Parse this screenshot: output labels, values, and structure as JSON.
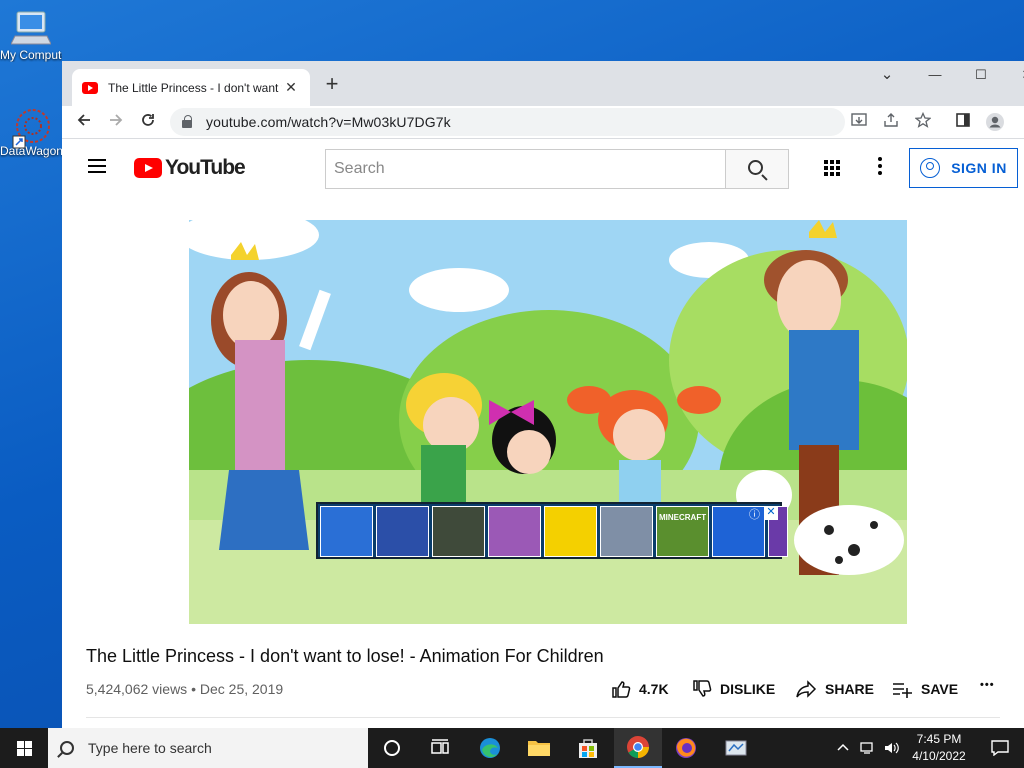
{
  "desktop": {
    "icons": [
      {
        "label": "My Computer"
      },
      {
        "label": "DataWagon"
      }
    ]
  },
  "browser": {
    "tab_title": "The Little Princess - I don't want to lose! - Animation For Children - YouTube",
    "tab_close": "✕",
    "new_tab": "+",
    "window_controls": {
      "tabsearch": "⌄",
      "minimize": "—",
      "maximize": "☐",
      "close": "✕"
    },
    "url": "youtube.com/watch?v=Mw03kU7DG7k"
  },
  "youtube": {
    "logo_text": "YouTube",
    "search_placeholder": "Search",
    "signin_label": "SIGN IN",
    "video": {
      "title": "The Little Princess - I don't want to lose! - Animation For Children",
      "views": "5,424,062 views",
      "separator": "•",
      "date": "Dec 25, 2019"
    },
    "actions": {
      "likes": "4.7K",
      "dislike": "DISLIKE",
      "share": "SHARE",
      "save": "SAVE",
      "more": "•••"
    },
    "ad": {
      "tile_colors": [
        "#2a6fd6",
        "#2b4fa8",
        "#3f4a3a",
        "#9b59b6",
        "#f4d000",
        "#7f8fa6",
        "#5a8f2e",
        "#1e63d6",
        "#6a3aa8"
      ],
      "tile_labels": [
        "",
        "",
        "",
        "",
        "",
        "",
        "MINECRAFT",
        "",
        ""
      ],
      "info": "ⓘ",
      "close": "✕"
    }
  },
  "taskbar": {
    "search_placeholder": "Type here to search",
    "time": "7:45 PM",
    "date": "4/10/2022"
  }
}
